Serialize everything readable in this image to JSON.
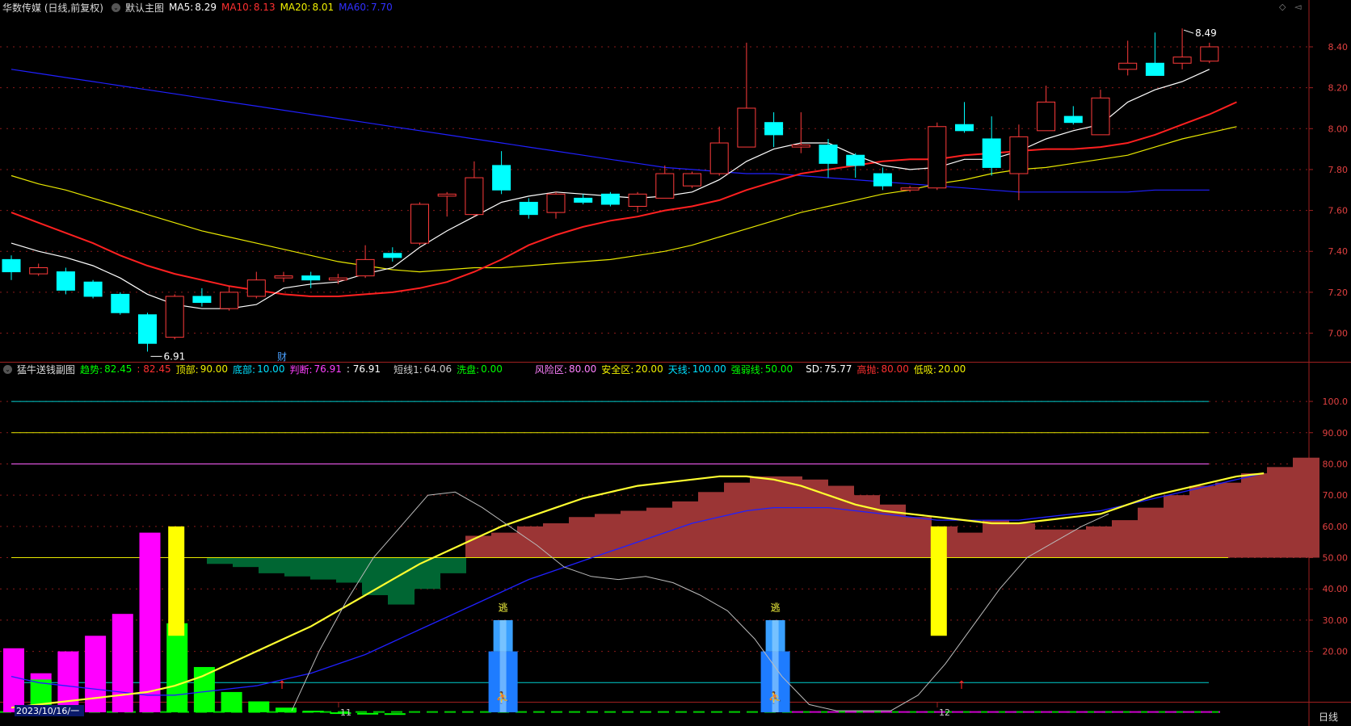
{
  "main_header": {
    "stock": "华数传媒 (日线,前复权)",
    "view": "默认主图",
    "ma5_label": "MA5:",
    "ma5": "8.29",
    "ma10_label": "MA10:",
    "ma10": "8.13",
    "ma20_label": "MA20:",
    "ma20": "8.01",
    "ma60_label": "MA60:",
    "ma60": "7.70"
  },
  "sub_header": {
    "name": "猛牛送钱副图",
    "trend_label": "趋势:",
    "trend": "82.45",
    "trend2": ": 82.45",
    "top_label": "顶部:",
    "top": "90.00",
    "bottom_label": "底部:",
    "bottom": "10.00",
    "judge_label": "判断:",
    "judge": "76.91",
    "judge2": ": 76.91",
    "short_label": "短线1:",
    "short": "64.06",
    "wash_label": "洗盘:",
    "wash": "0.00",
    "risk_label": "风险区:",
    "risk": "80.00",
    "safe_label": "安全区:",
    "safe": "20.00",
    "sky_label": "天线:",
    "sky": "100.00",
    "strong_label": "强弱线:",
    "strong": "50.00",
    "sd_label": "SD:",
    "sd": "75.77",
    "high_label": "高抛:",
    "high": "80.00",
    "low_label": "低吸:",
    "low": "20.00"
  },
  "price_axis": [
    "8.40",
    "8.20",
    "8.00",
    "7.80",
    "7.60",
    "7.40",
    "7.20",
    "7.00"
  ],
  "osc_axis": [
    "100.0",
    "90.00",
    "80.00",
    "70.00",
    "60.00",
    "50.00",
    "40.00",
    "30.00",
    "20.00"
  ],
  "annotations": {
    "high_mark": "8.49",
    "low_mark": "6.91",
    "cai": "财",
    "escape1": "逃",
    "escape2": "逃"
  },
  "date_axis": {
    "start": "2023/10/16/一",
    "m11": "11",
    "m12": "12"
  },
  "bottom_right": "日线",
  "colors": {
    "up": "#ff3b3b",
    "down": "#00ffff",
    "ma5": "#ffffff",
    "ma10": "#ff2020",
    "ma20": "#e8e800",
    "ma60": "#2020ff",
    "green_area": "#006633",
    "red_area": "#9b3535"
  },
  "chart_data": {
    "type": "candlestick",
    "price_ylim": [
      6.86,
      8.55
    ],
    "candles": [
      [
        7.36,
        7.3,
        7.38,
        7.26
      ],
      [
        7.29,
        7.32,
        7.34,
        7.28
      ],
      [
        7.3,
        7.21,
        7.32,
        7.19
      ],
      [
        7.25,
        7.18,
        7.26,
        7.17
      ],
      [
        7.19,
        7.1,
        7.2,
        7.09
      ],
      [
        7.09,
        6.95,
        7.1,
        6.91
      ],
      [
        6.98,
        7.18,
        7.19,
        6.97
      ],
      [
        7.18,
        7.15,
        7.22,
        7.13
      ],
      [
        7.12,
        7.2,
        7.23,
        7.11
      ],
      [
        7.18,
        7.26,
        7.3,
        7.17
      ],
      [
        7.27,
        7.28,
        7.3,
        7.25
      ],
      [
        7.28,
        7.26,
        7.3,
        7.22
      ],
      [
        7.26,
        7.27,
        7.29,
        7.24
      ],
      [
        7.28,
        7.36,
        7.43,
        7.27
      ],
      [
        7.39,
        7.37,
        7.42,
        7.35
      ],
      [
        7.44,
        7.63,
        7.64,
        7.43
      ],
      [
        7.67,
        7.68,
        7.69,
        7.57
      ],
      [
        7.58,
        7.76,
        7.84,
        7.57
      ],
      [
        7.82,
        7.7,
        7.89,
        7.68
      ],
      [
        7.64,
        7.58,
        7.66,
        7.56
      ],
      [
        7.59,
        7.68,
        7.69,
        7.56
      ],
      [
        7.66,
        7.64,
        7.68,
        7.63
      ],
      [
        7.68,
        7.63,
        7.69,
        7.62
      ],
      [
        7.62,
        7.68,
        7.69,
        7.59
      ],
      [
        7.66,
        7.78,
        7.82,
        7.66
      ],
      [
        7.72,
        7.78,
        7.79,
        7.71
      ],
      [
        7.78,
        7.93,
        8.01,
        7.77
      ],
      [
        7.91,
        8.1,
        8.42,
        7.91
      ],
      [
        8.03,
        7.97,
        8.08,
        7.91
      ],
      [
        7.91,
        7.92,
        8.08,
        7.88
      ],
      [
        7.92,
        7.83,
        7.95,
        7.76
      ],
      [
        7.87,
        7.82,
        7.88,
        7.76
      ],
      [
        7.78,
        7.72,
        7.81,
        7.7
      ],
      [
        7.7,
        7.71,
        7.72,
        7.69
      ],
      [
        7.71,
        8.01,
        8.03,
        7.7
      ],
      [
        8.02,
        7.99,
        8.13,
        7.98
      ],
      [
        7.95,
        7.81,
        8.06,
        7.77
      ],
      [
        7.78,
        7.96,
        8.02,
        7.65
      ],
      [
        7.99,
        8.13,
        8.21,
        7.99
      ],
      [
        8.06,
        8.03,
        8.11,
        8.02
      ],
      [
        7.97,
        8.15,
        8.19,
        7.97
      ],
      [
        8.29,
        8.32,
        8.43,
        8.26
      ],
      [
        8.32,
        8.26,
        8.47,
        8.26
      ],
      [
        8.32,
        8.35,
        8.49,
        8.29
      ],
      [
        8.33,
        8.4,
        8.42,
        8.32
      ]
    ],
    "ma5": [
      7.44,
      7.4,
      7.37,
      7.33,
      7.27,
      7.19,
      7.14,
      7.12,
      7.12,
      7.14,
      7.22,
      7.24,
      7.25,
      7.29,
      7.32,
      7.42,
      7.5,
      7.57,
      7.64,
      7.67,
      7.69,
      7.68,
      7.67,
      7.66,
      7.67,
      7.69,
      7.75,
      7.84,
      7.9,
      7.93,
      7.93,
      7.87,
      7.82,
      7.8,
      7.81,
      7.85,
      7.85,
      7.89,
      7.95,
      7.99,
      8.02,
      8.13,
      8.19,
      8.23,
      8.29
    ],
    "ma10": [
      7.59,
      7.54,
      7.49,
      7.44,
      7.38,
      7.33,
      7.29,
      7.26,
      7.23,
      7.21,
      7.19,
      7.18,
      7.18,
      7.19,
      7.2,
      7.22,
      7.25,
      7.3,
      7.36,
      7.43,
      7.48,
      7.52,
      7.55,
      7.57,
      7.6,
      7.62,
      7.65,
      7.7,
      7.74,
      7.78,
      7.8,
      7.82,
      7.84,
      7.85,
      7.85,
      7.87,
      7.88,
      7.89,
      7.9,
      7.9,
      7.91,
      7.93,
      7.97,
      8.02,
      8.07,
      8.13
    ],
    "ma20": [
      7.77,
      7.73,
      7.7,
      7.66,
      7.62,
      7.58,
      7.54,
      7.5,
      7.47,
      7.44,
      7.41,
      7.38,
      7.35,
      7.33,
      7.31,
      7.3,
      7.31,
      7.32,
      7.32,
      7.33,
      7.34,
      7.35,
      7.36,
      7.38,
      7.4,
      7.43,
      7.47,
      7.51,
      7.55,
      7.59,
      7.62,
      7.65,
      7.68,
      7.7,
      7.73,
      7.75,
      7.78,
      7.8,
      7.81,
      7.83,
      7.85,
      7.87,
      7.91,
      7.95,
      7.98,
      8.01
    ],
    "ma60": [
      8.29,
      8.27,
      8.25,
      8.23,
      8.21,
      8.19,
      8.17,
      8.15,
      8.13,
      8.11,
      8.09,
      8.07,
      8.05,
      8.03,
      8.01,
      7.99,
      7.97,
      7.95,
      7.93,
      7.91,
      7.89,
      7.87,
      7.85,
      7.83,
      7.81,
      7.8,
      7.79,
      7.78,
      7.78,
      7.77,
      7.76,
      7.75,
      7.74,
      7.73,
      7.72,
      7.71,
      7.7,
      7.69,
      7.69,
      7.69,
      7.69,
      7.69,
      7.7,
      7.7,
      7.7
    ],
    "osc_ylim": [
      0,
      107
    ],
    "osc_levels": [
      100,
      90,
      80,
      50,
      10
    ],
    "osc_area": [
      50,
      50,
      50,
      50,
      50,
      50,
      50,
      50,
      48,
      47,
      45,
      44,
      43,
      42,
      38,
      35,
      40,
      45,
      57,
      58,
      60,
      61,
      63,
      64,
      65,
      66,
      68,
      71,
      74,
      76,
      76,
      75,
      73,
      70,
      67,
      63,
      60,
      58,
      62,
      61,
      59,
      59,
      60,
      62,
      66,
      70,
      73,
      74,
      77,
      79,
      82
    ],
    "magenta_bars": [
      21,
      13,
      20,
      25,
      32,
      58,
      0,
      0,
      0,
      0,
      0
    ],
    "green_bars": [
      0,
      11,
      0,
      0,
      0,
      0,
      29,
      15,
      7,
      4,
      2,
      1,
      0.5,
      0.3,
      0.2
    ],
    "yellow_bars": [
      {
        "i": 6,
        "from": 25,
        "to": 60
      },
      {
        "i": 34,
        "from": 25,
        "to": 60
      }
    ],
    "blue_towers": [
      18,
      28
    ],
    "trend_yellow": [
      2,
      3,
      4,
      5,
      6,
      7,
      9,
      12,
      16,
      20,
      24,
      28,
      33,
      38,
      43,
      48,
      52,
      56,
      60,
      63,
      66,
      69,
      71,
      73,
      74,
      75,
      76,
      76,
      75,
      73,
      70,
      67,
      65,
      64,
      63,
      62,
      61,
      61,
      62,
      63,
      64,
      67,
      70,
      72,
      74,
      76,
      77
    ],
    "blue_line": [
      12,
      10,
      9,
      8,
      7,
      6,
      6,
      7,
      8,
      9,
      11,
      13,
      16,
      19,
      23,
      27,
      31,
      35,
      39,
      43,
      46,
      49,
      52,
      55,
      58,
      61,
      63,
      65,
      66,
      66,
      66,
      65,
      64,
      63,
      62,
      62,
      62,
      62,
      63,
      64,
      65,
      67,
      69,
      71,
      73,
      75,
      77
    ],
    "white_line": [
      null,
      null,
      null,
      null,
      null,
      null,
      null,
      null,
      null,
      null,
      1,
      20,
      36,
      50,
      60,
      70,
      71,
      66,
      60,
      54,
      47,
      44,
      43,
      44,
      42,
      38,
      33,
      24,
      12,
      3,
      1,
      1,
      1,
      6,
      16,
      28,
      40,
      50,
      55,
      60,
      64
    ]
  }
}
